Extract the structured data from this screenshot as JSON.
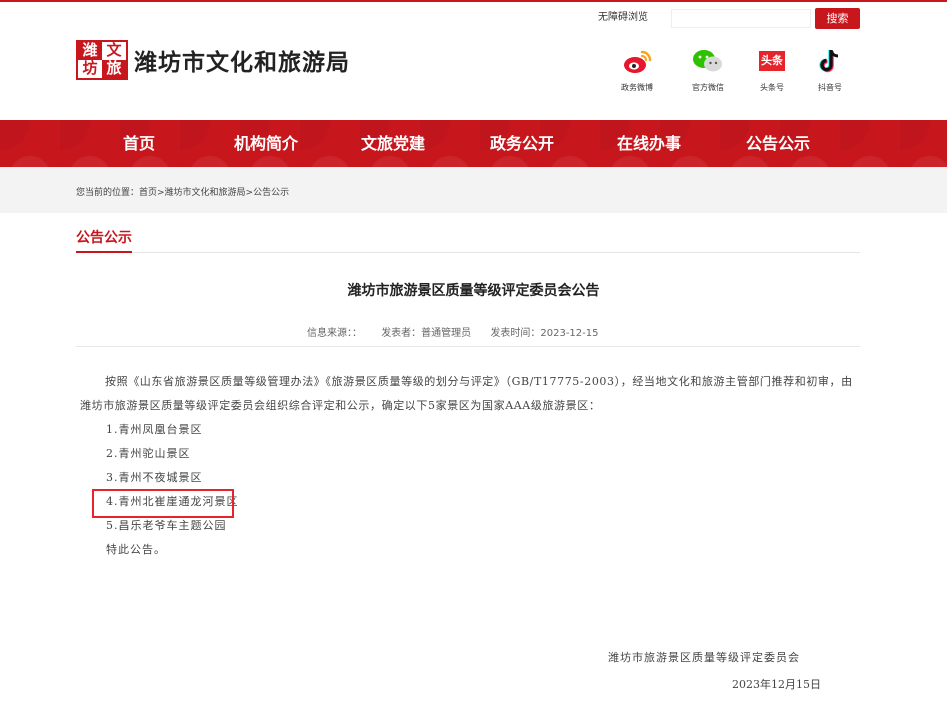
{
  "header": {
    "accessibility_link": "无障碍浏览",
    "search_placeholder": "",
    "search_button": "搜索",
    "logo_seal": [
      "潍",
      "文",
      "坊",
      "旅"
    ],
    "site_title": "潍坊市文化和旅游局",
    "social": [
      {
        "label": "政务微博",
        "icon": "weibo-icon"
      },
      {
        "label": "官方微信",
        "icon": "wechat-icon"
      },
      {
        "label": "头条号",
        "icon": "toutiao-icon",
        "badge": "头条"
      },
      {
        "label": "抖音号",
        "icon": "douyin-icon"
      }
    ]
  },
  "nav": {
    "items": [
      "首页",
      "机构简介",
      "文旅党建",
      "政务公开",
      "在线办事",
      "公告公示"
    ]
  },
  "breadcrumb": {
    "prefix": "您当前的位置：",
    "path": "首页>潍坊市文化和旅游局>公告公示"
  },
  "section": {
    "title": "公告公示"
  },
  "article": {
    "title": "潍坊市旅游景区质量等级评定委员会公告",
    "meta": {
      "source": "信息来源：：",
      "publisher": "发表者：普通管理员",
      "time": "发表时间：2023-12-15"
    },
    "paragraph": "按照《山东省旅游景区质量等级管理办法》《旅游景区质量等级的划分与评定》（GB/T17775-2003），经当地文化和旅游主管部门推荐和初审，由潍坊市旅游景区质量等级评定委员会组织综合评定和公示，确定以下5家景区为国家AAA级旅游景区：",
    "items": [
      "1.青州凤凰台景区",
      "2.青州驼山景区",
      "3.青州不夜城景区",
      "4.青州北崔崖通龙河景区",
      "5.昌乐老爷车主题公园"
    ],
    "closing": "特此公告。",
    "signature": "潍坊市旅游景区质量等级评定委员会",
    "date": "2023年12月15日"
  },
  "colors": {
    "brand_red": "#c8161d",
    "highlight_box": "#e8242b"
  }
}
